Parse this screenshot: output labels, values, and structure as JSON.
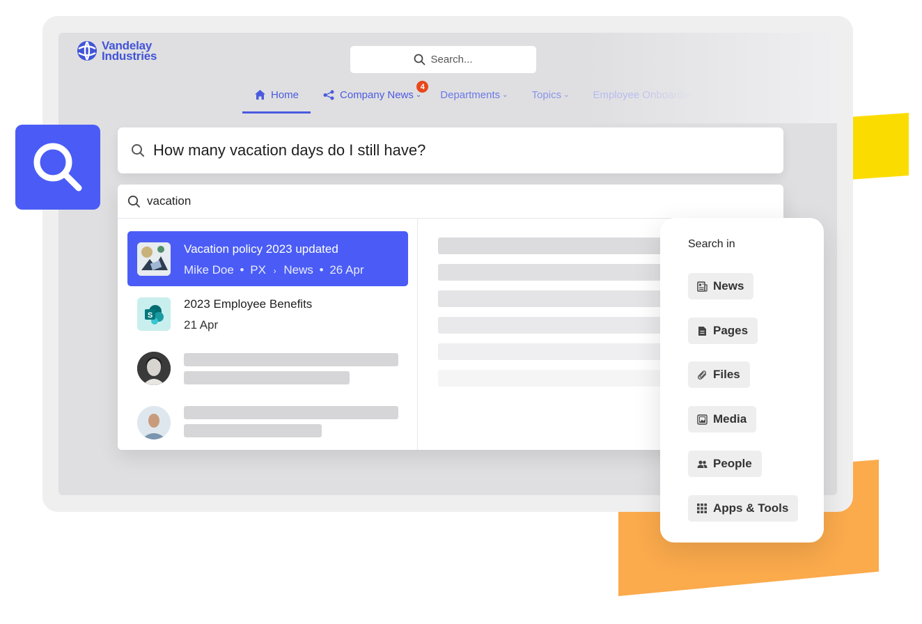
{
  "logo": {
    "line1": "Vandelay",
    "line2": "Industries"
  },
  "top_search": {
    "placeholder": "Search..."
  },
  "nav": {
    "items": [
      {
        "label": "Home",
        "icon": "home-icon"
      },
      {
        "label": "Company News",
        "icon": "share-icon",
        "badge": "4"
      },
      {
        "label": "Departments"
      },
      {
        "label": "Topics"
      },
      {
        "label": "Employee Onboarding"
      }
    ]
  },
  "query": {
    "text": "How many vacation days do I still have?"
  },
  "results": {
    "search_value": "vacation",
    "items": [
      {
        "title": "Vacation policy 2023 updated",
        "author": "Mike Doe",
        "section": "PX",
        "category": "News",
        "date": "26 Apr",
        "active": true
      },
      {
        "title": "2023 Employee Benefits",
        "date": "21 Apr",
        "icon": "sharepoint-icon"
      }
    ]
  },
  "search_in": {
    "title": "Search in",
    "options": [
      {
        "label": "News",
        "icon": "news-icon"
      },
      {
        "label": "Pages",
        "icon": "page-icon"
      },
      {
        "label": "Files",
        "icon": "paperclip-icon"
      },
      {
        "label": "Media",
        "icon": "image-icon"
      },
      {
        "label": "People",
        "icon": "people-icon"
      },
      {
        "label": "Apps & Tools",
        "icon": "grid-icon"
      }
    ]
  },
  "colors": {
    "accent": "#4a5cf5",
    "yellow": "#fbdc00",
    "orange": "#fbaa4c",
    "badge": "#e8481c"
  }
}
